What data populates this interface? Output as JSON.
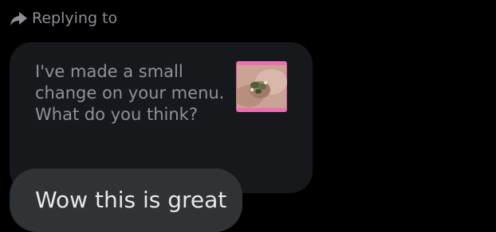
{
  "reply_header": {
    "label": "Replying to",
    "icon": "reply-arrow-icon"
  },
  "quoted_message": {
    "text": "I've made a small change on your menu. What do you think?",
    "thumbnail": "image-thumbnail"
  },
  "reply_message": {
    "text": "Wow this is great"
  },
  "colors": {
    "background": "#000000",
    "quoted_bubble": "#16181c",
    "reply_bubble": "#2f3336",
    "muted_text": "#8e9299",
    "primary_text": "#e7e9ea",
    "thumbnail_border": "#e85aa8"
  }
}
